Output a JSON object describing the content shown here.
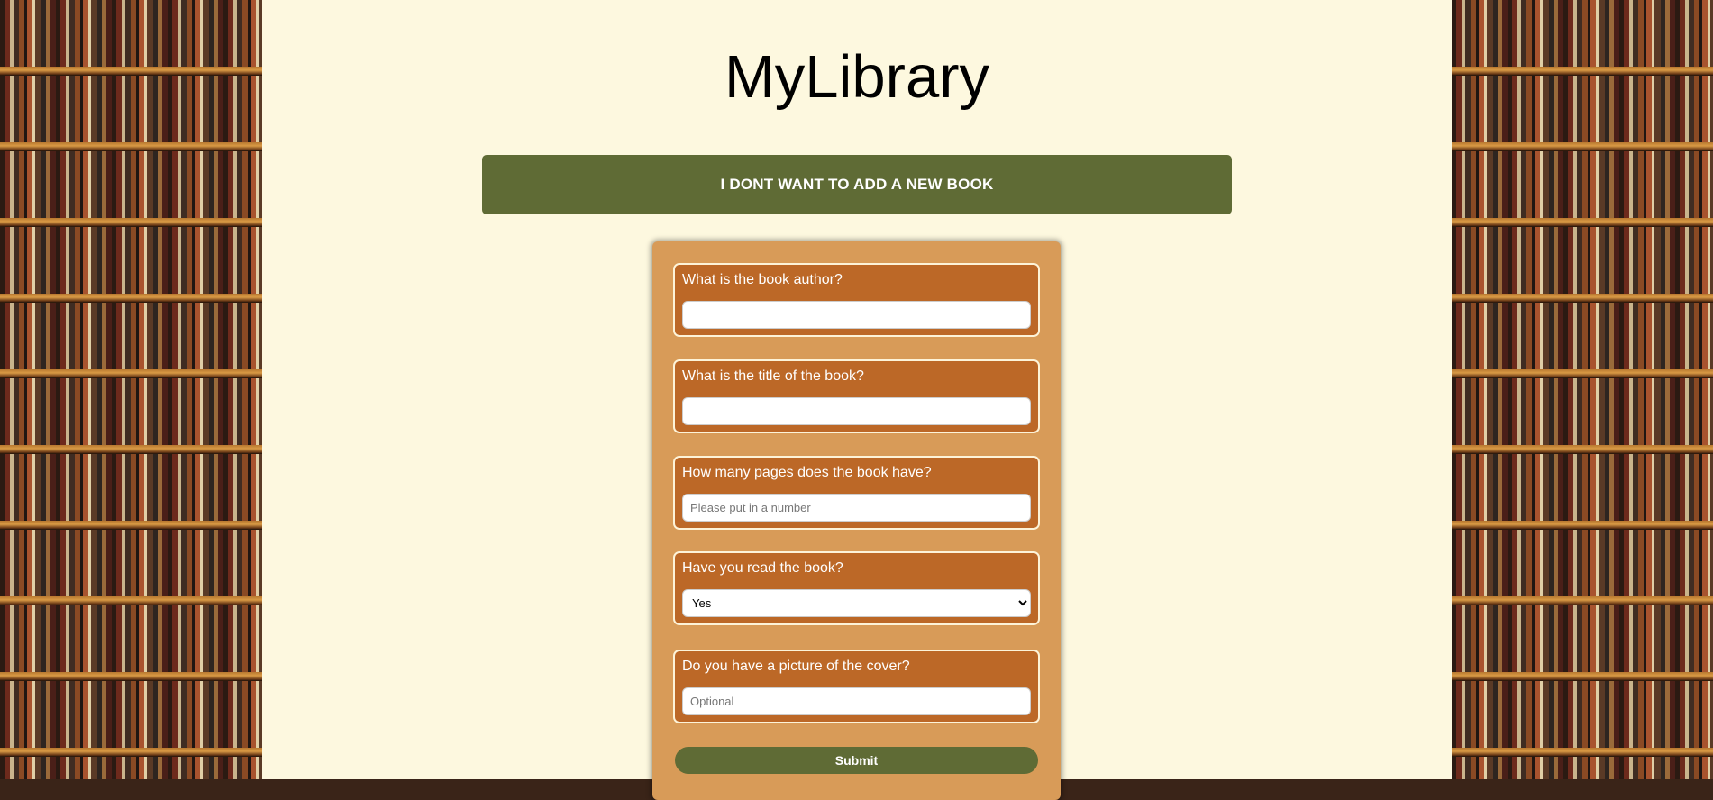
{
  "header": {
    "title": "MyLibrary"
  },
  "toggle": {
    "label": "I DONT WANT TO ADD A NEW BOOK"
  },
  "form": {
    "fields": [
      {
        "label": "What is the book author?",
        "value": "",
        "placeholder": ""
      },
      {
        "label": "What is the title of the book?",
        "value": "",
        "placeholder": ""
      },
      {
        "label": "How many pages does the book have?",
        "value": "",
        "placeholder": "Please put in a number"
      },
      {
        "label": "Have you read the book?",
        "selected": "Yes"
      },
      {
        "label": "Do you have a picture of the cover?",
        "value": "",
        "placeholder": "Optional"
      }
    ],
    "submit_label": "Submit"
  },
  "colors": {
    "page_background": "#fdf8df",
    "accent_green": "#5f6b35",
    "form_background": "#d89b58",
    "field_background": "#bc6827"
  }
}
